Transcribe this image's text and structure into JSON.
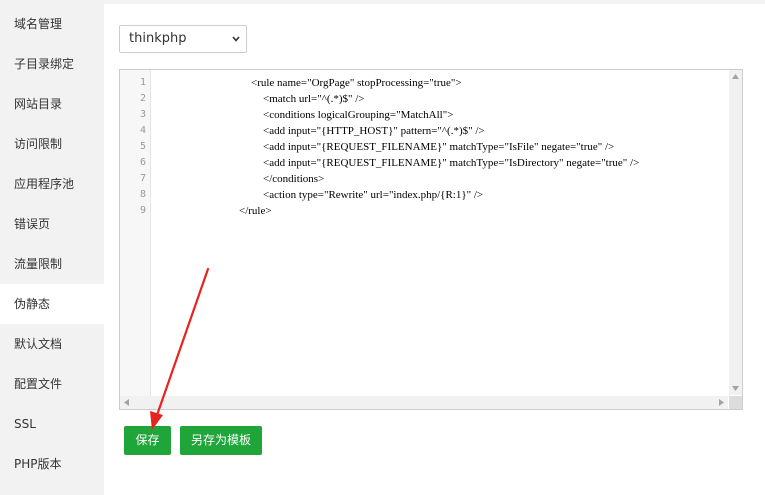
{
  "sidebar": {
    "items": [
      {
        "label": "域名管理"
      },
      {
        "label": "子目录绑定"
      },
      {
        "label": "网站目录"
      },
      {
        "label": "访问限制"
      },
      {
        "label": "应用程序池"
      },
      {
        "label": "错误页"
      },
      {
        "label": "流量限制"
      },
      {
        "label": "伪静态"
      },
      {
        "label": "默认文档"
      },
      {
        "label": "配置文件"
      },
      {
        "label": "SSL"
      },
      {
        "label": "PHP版本"
      }
    ],
    "active_label": "伪静态"
  },
  "template_select": {
    "value": "thinkphp"
  },
  "editor": {
    "line_numbers": [
      "1",
      "2",
      "3",
      "4",
      "5",
      "6",
      "7",
      "8",
      "9"
    ],
    "lines": [
      "<rule name=\"OrgPage\" stopProcessing=\"true\">",
      "<match url=\"^(.*)$\" />",
      "<conditions logicalGrouping=\"MatchAll\">",
      "<add input=\"{HTTP_HOST}\" pattern=\"^(.*)$\" />",
      "<add input=\"{REQUEST_FILENAME}\" matchType=\"IsFile\" negate=\"true\" />",
      "<add input=\"{REQUEST_FILENAME}\" matchType=\"IsDirectory\" negate=\"true\" />",
      "</conditions>",
      "<action type=\"Rewrite\" url=\"index.php/{R:1}\" />",
      "</rule>"
    ]
  },
  "buttons": {
    "save_label": "保存",
    "save_as_template_label": "另存为模板"
  },
  "colors": {
    "accent": "#20a53a",
    "annotation_arrow": "#e8231f"
  }
}
